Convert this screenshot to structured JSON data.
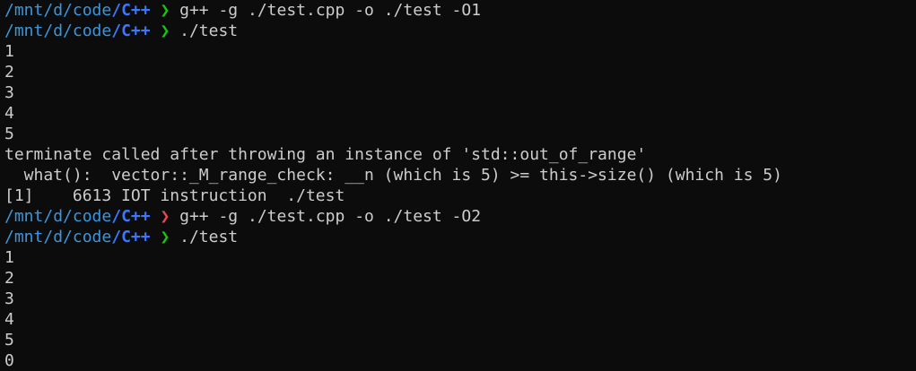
{
  "terminal": {
    "colors": {
      "background": "#0c0c0c",
      "foreground": "#cccccc",
      "path": "#3a96dd",
      "path_current": "#3b78ff",
      "prompt_ok": "#16c60c",
      "prompt_err": "#e74856"
    },
    "prompt": {
      "path_parts": [
        "/mnt",
        "/d",
        "/code",
        "/C++"
      ],
      "chevron_glyph": "❯"
    },
    "lines": [
      {
        "type": "prompt",
        "status": "ok",
        "command": "g++ -g ./test.cpp -o ./test -O1"
      },
      {
        "type": "prompt",
        "status": "ok",
        "command": "./test"
      },
      {
        "type": "output",
        "text": "1"
      },
      {
        "type": "output",
        "text": "2"
      },
      {
        "type": "output",
        "text": "3"
      },
      {
        "type": "output",
        "text": "4"
      },
      {
        "type": "output",
        "text": "5"
      },
      {
        "type": "output",
        "text": "terminate called after throwing an instance of 'std::out_of_range'"
      },
      {
        "type": "output",
        "text": "  what():  vector::_M_range_check: __n (which is 5) >= this->size() (which is 5)"
      },
      {
        "type": "output",
        "text": "[1]    6613 IOT instruction  ./test"
      },
      {
        "type": "prompt",
        "status": "err",
        "command": "g++ -g ./test.cpp -o ./test -O2"
      },
      {
        "type": "prompt",
        "status": "ok",
        "command": "./test"
      },
      {
        "type": "output",
        "text": "1"
      },
      {
        "type": "output",
        "text": "2"
      },
      {
        "type": "output",
        "text": "3"
      },
      {
        "type": "output",
        "text": "4"
      },
      {
        "type": "output",
        "text": "5"
      },
      {
        "type": "output",
        "text": "0"
      }
    ]
  }
}
